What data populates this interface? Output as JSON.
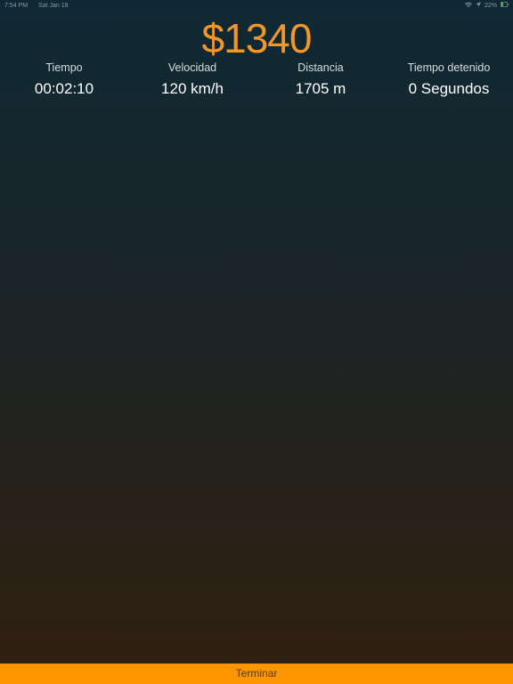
{
  "status_bar": {
    "time": "7:54 PM",
    "date": "Sat Jan 18",
    "battery": "22%",
    "icons": [
      "wifi-icon",
      "location-arrow-icon",
      "battery-icon"
    ]
  },
  "trip": {
    "fare": "$1340",
    "stats": [
      {
        "label": "Tiempo",
        "value": "00:02:10"
      },
      {
        "label": "Velocidad",
        "value": "120 km/h"
      },
      {
        "label": "Distancia",
        "value": "1705 m"
      },
      {
        "label": "Tiempo detenido",
        "value": "0 Segundos"
      }
    ]
  },
  "footer": {
    "finish_label": "Terminar"
  },
  "colors": {
    "accent": "#f0962b",
    "button": "#ff9500",
    "background_top": "#0f2934",
    "background_bottom": "#30200f"
  }
}
